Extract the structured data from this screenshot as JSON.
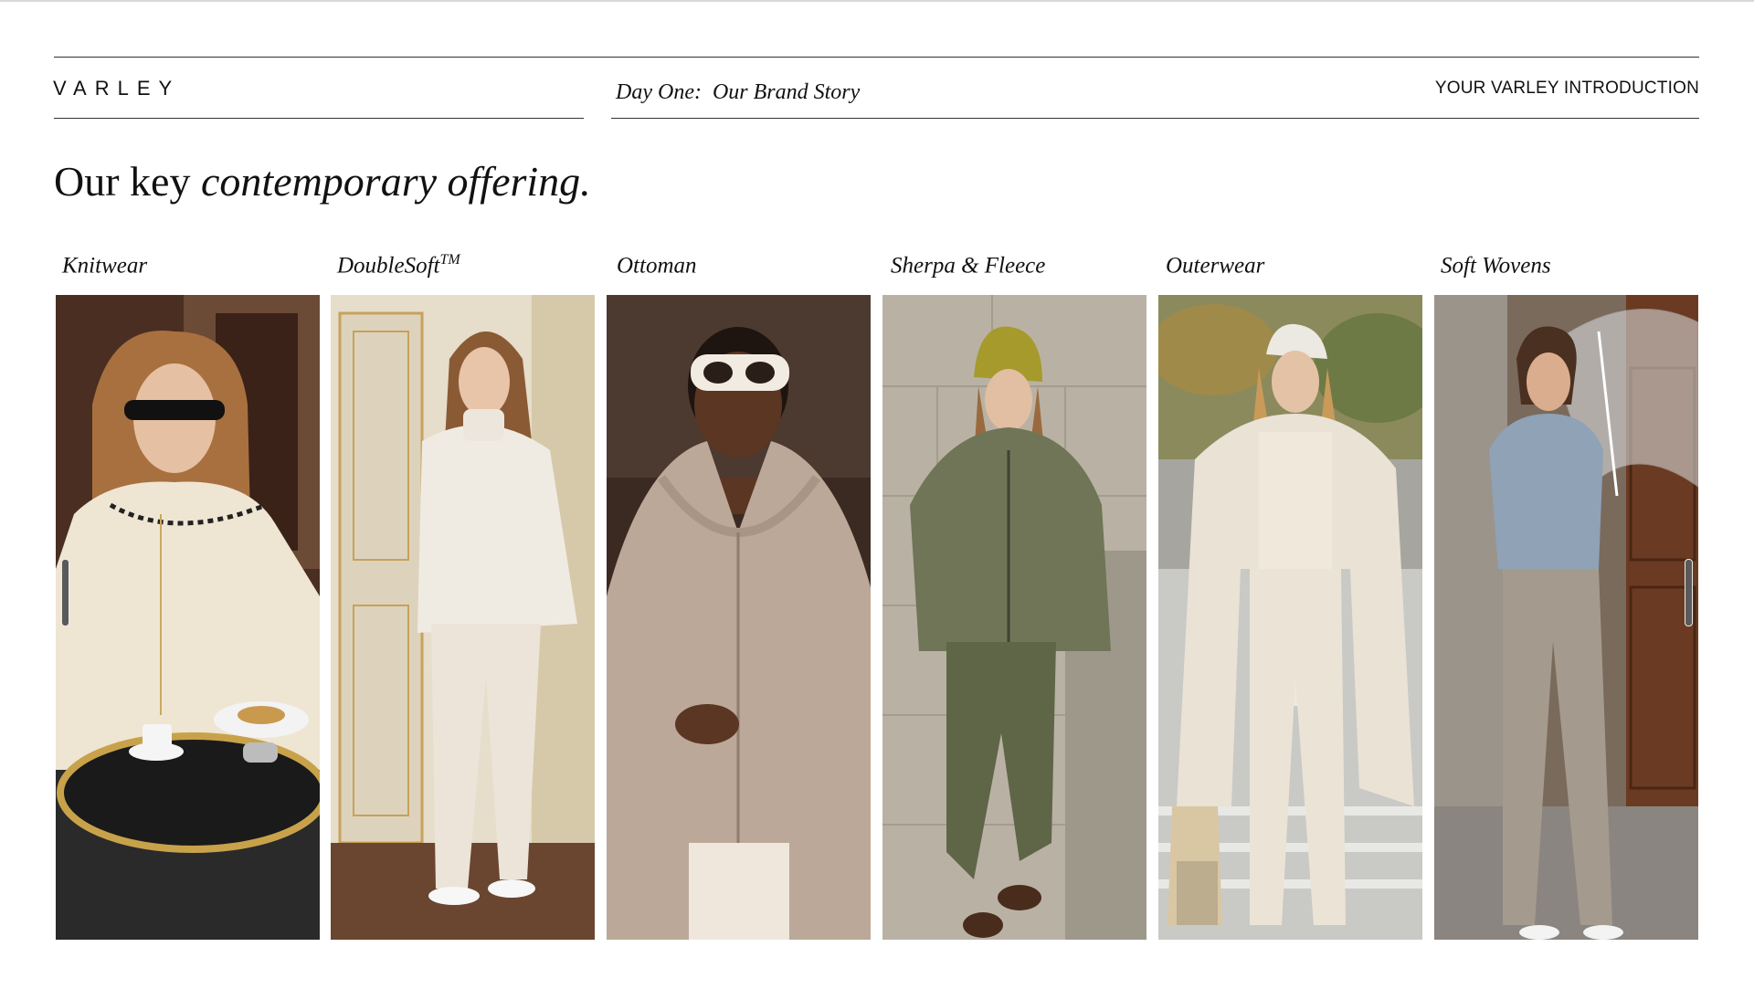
{
  "header": {
    "logo": "VARLEY",
    "section": "Day One:  Our Brand Story",
    "deck_title": "YOUR VARLEY INTRODUCTION"
  },
  "headline": {
    "plain": "Our key ",
    "italic": "contemporary offering."
  },
  "categories": [
    {
      "label": "Knitwear",
      "sup": ""
    },
    {
      "label": "DoubleSoft",
      "sup": "TM"
    },
    {
      "label": "Ottoman",
      "sup": ""
    },
    {
      "label": "Sherpa & Fleece",
      "sup": ""
    },
    {
      "label": "Outerwear",
      "sup": ""
    },
    {
      "label": "Soft Wovens",
      "sup": ""
    }
  ],
  "colors": {
    "text": "#111111",
    "rule": "#333333",
    "knitwear_bg": "#4a2e22",
    "doublesoft_bg": "#e6ddcb",
    "ottoman_bg": "#3b2a22",
    "sherpa_bg": "#b9b2a4",
    "outerwear_bg": "#9a9a80",
    "softwovens_bg": "#7a6a5c"
  }
}
